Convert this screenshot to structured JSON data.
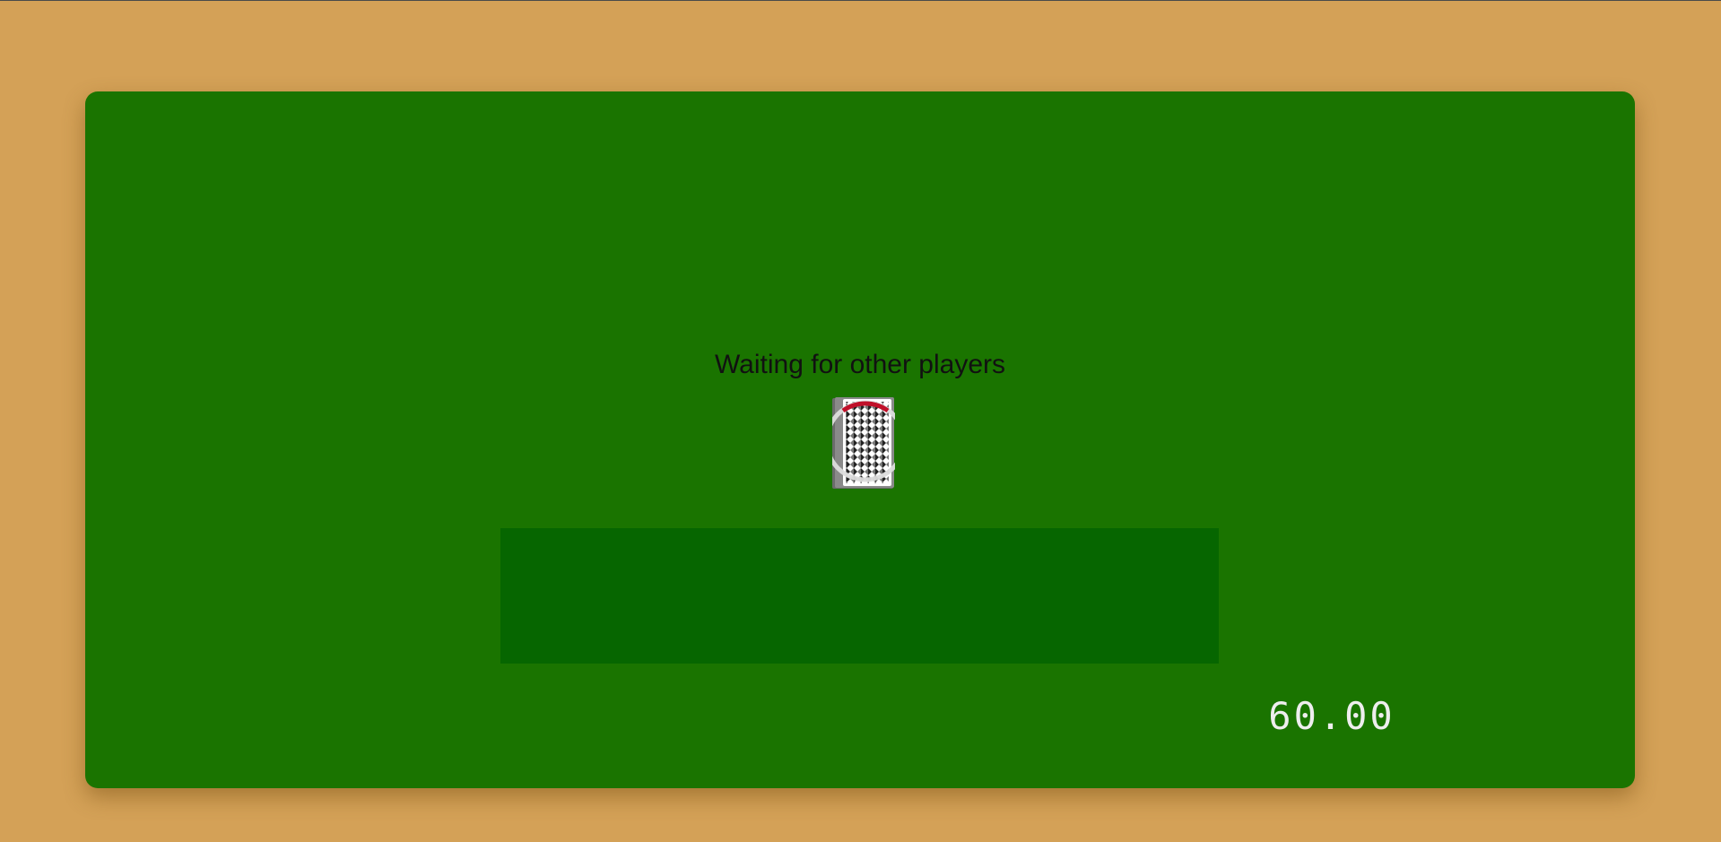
{
  "table": {
    "status_text": "Waiting for other players",
    "timer": "60.00",
    "deck_icon": "card-back-icon",
    "loading_icon": "loading-spinner-icon"
  },
  "colors": {
    "background": "#D4A157",
    "felt": "#1A7400",
    "hand_area": "#066600",
    "spinner_accent": "#C0102A",
    "timer_text": "#EEEEEE"
  }
}
